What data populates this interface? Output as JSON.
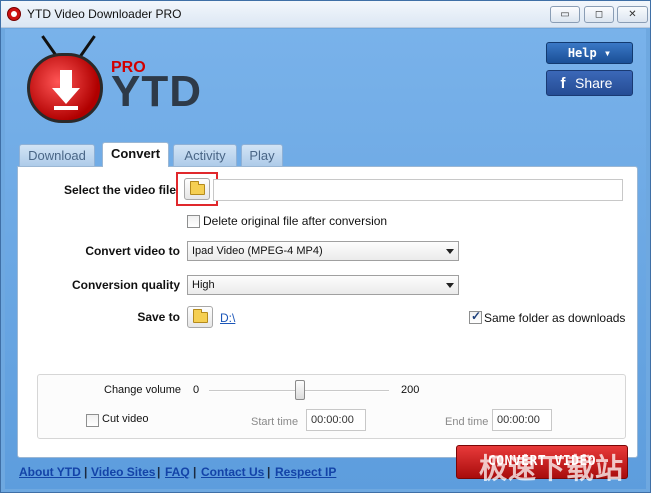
{
  "window": {
    "title": "YTD Video Downloader PRO",
    "minimize": "▭",
    "maximize": "◻",
    "close": "✕"
  },
  "logo": {
    "pro": "PRO",
    "name": "YTD"
  },
  "header": {
    "help_label": "Help ▾",
    "share_label": "Share",
    "share_icon": "f"
  },
  "tabs": [
    {
      "label": "Download",
      "active": false
    },
    {
      "label": "Convert",
      "active": true
    },
    {
      "label": "Activity",
      "active": false
    },
    {
      "label": "Play",
      "active": false
    }
  ],
  "convert": {
    "select_file_label": "Select the video file",
    "select_file_value": "",
    "delete_original_label": "Delete original file after conversion",
    "delete_original_checked": false,
    "convert_to_label": "Convert video to",
    "convert_to_value": "Ipad Video (MPEG-4 MP4)",
    "quality_label": "Conversion quality",
    "quality_value": "High",
    "save_to_label": "Save to",
    "save_to_path": "D:\\",
    "same_folder_label": "Same folder as downloads",
    "same_folder_checked": true,
    "volume_label": "Change volume",
    "volume_min": "0",
    "volume_max": "200",
    "volume_value": 100,
    "cut_video_label": "Cut video",
    "cut_video_checked": false,
    "start_time_label": "Start time",
    "start_time_value": "00:00:00",
    "end_time_label": "End time",
    "end_time_value": "00:00:00",
    "convert_button": "CONVERT VIDEO"
  },
  "footer": {
    "links": [
      "About YTD",
      "Video Sites",
      "FAQ",
      "Contact Us",
      "Respect IP"
    ],
    "separator": "|"
  },
  "watermark": "极速下载站",
  "colors": {
    "accent": "#6ea8e0",
    "convert_button": "#c41a1a",
    "link": "#1343a8",
    "highlight": "#e0282c"
  }
}
